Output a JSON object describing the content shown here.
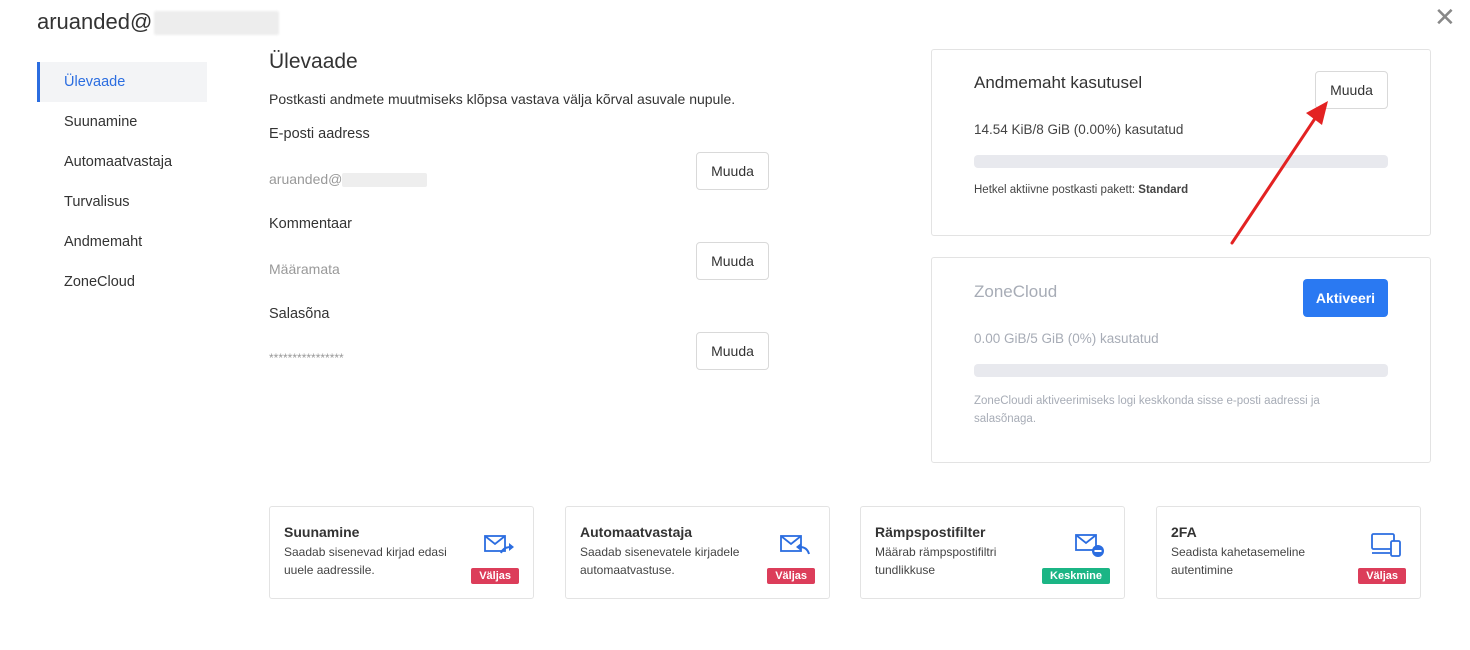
{
  "header": {
    "account": "aruanded@",
    "close_icon": "close-icon"
  },
  "nav": {
    "items": [
      {
        "label": "Ülevaade"
      },
      {
        "label": "Suunamine"
      },
      {
        "label": "Automaatvastaja"
      },
      {
        "label": "Turvalisus"
      },
      {
        "label": "Andmemaht"
      },
      {
        "label": "ZoneCloud"
      }
    ],
    "active": "Ülevaade"
  },
  "overview": {
    "title": "Ülevaade",
    "description": "Postkasti andmete muutmiseks klõpsa vastava välja kõrval asuvale nupule.",
    "fields": [
      {
        "label": "E-posti aadress",
        "value": "aruanded@",
        "button": "Muuda"
      },
      {
        "label": "Kommentaar",
        "value": "Määramata",
        "button": "Muuda"
      },
      {
        "label": "Salasõna",
        "value": "****************",
        "button": "Muuda"
      }
    ]
  },
  "storage": {
    "title": "Andmemaht kasutusel",
    "button": "Muuda",
    "usage": "14.54 KiB/8 GiB (0.00%) kasutatud",
    "usage_fraction": 0.0,
    "plan_label": "Hetkel aktiivne postkasti pakett:",
    "plan_value": "Standard"
  },
  "zonecloud": {
    "title": "ZoneCloud",
    "button": "Aktiveeri",
    "usage": "0.00 GiB/5 GiB (0%) kasutatud",
    "usage_fraction": 0.0,
    "note": "ZoneCloudi aktiveerimiseks logi keskkonda sisse e-posti aadressi ja salasõnaga."
  },
  "features": [
    {
      "title": "Suunamine",
      "desc": "Saadab sisenevad kirjad edasi uuele aadressile.",
      "badge": "Väljas",
      "icon": "mail-forward-icon"
    },
    {
      "title": "Automaatvastaja",
      "desc": "Saadab sisenevatele kirjadele automaatvastuse.",
      "badge": "Väljas",
      "icon": "mail-reply-icon"
    },
    {
      "title": "Rämpspostifilter",
      "desc": "Määrab rämpspostifiltri tundlikkuse",
      "badge": "Keskmine",
      "icon": "mail-block-icon"
    },
    {
      "title": "2FA",
      "desc": "Seadista kahetasemeline autentimine",
      "badge": "Väljas",
      "icon": "devices-icon"
    }
  ],
  "colors": {
    "accent": "#2b6de0",
    "badge_off": "#dc3d5a",
    "badge_medium": "#1bb585",
    "activate": "#2a79f2",
    "arrow": "#e32222"
  }
}
